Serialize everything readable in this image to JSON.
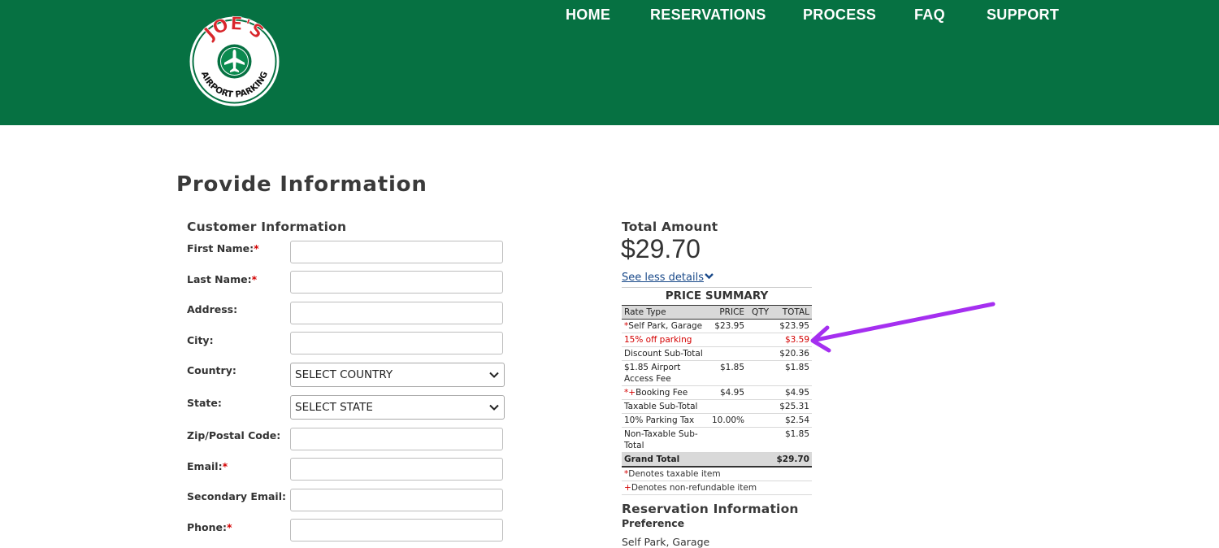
{
  "brand": {
    "logo_text_top": "JOE'S",
    "logo_text_bottom": "AIRPORT PARKING",
    "header_color": "#067142"
  },
  "nav": {
    "items": [
      "HOME",
      "RESERVATIONS",
      "PROCESS",
      "FAQ",
      "SUPPORT"
    ]
  },
  "page": {
    "title": "Provide Information"
  },
  "customer": {
    "heading": "Customer Information",
    "fields": [
      {
        "label": "First Name:",
        "required": "*",
        "value": ""
      },
      {
        "label": "Last Name:",
        "required": "*",
        "value": ""
      },
      {
        "label": "Address:",
        "required": "",
        "value": ""
      },
      {
        "label": "City:",
        "required": "",
        "value": ""
      },
      {
        "label": "Country:",
        "required": "",
        "value": "SELECT COUNTRY"
      },
      {
        "label": "State:",
        "required": "",
        "value": "SELECT STATE"
      },
      {
        "label": "Zip/Postal Code:",
        "required": "",
        "value": ""
      },
      {
        "label": "Email:",
        "required": "*",
        "value": ""
      },
      {
        "label": "Secondary Email:",
        "required": "",
        "value": ""
      },
      {
        "label": "Phone:",
        "required": "*",
        "value": ""
      }
    ]
  },
  "summary": {
    "total_label": "Total Amount",
    "total_amount": "$29.70",
    "details_link": "See less details",
    "table_title": "PRICE SUMMARY",
    "columns": [
      "Rate Type",
      "PRICE",
      "QTY",
      "TOTAL"
    ],
    "rows": [
      {
        "mark": "*",
        "type": "Self Park, Garage",
        "price": "$23.95",
        "qty": "",
        "total": "$23.95",
        "style": "row"
      },
      {
        "mark": "",
        "type": "15% off parking",
        "price": "",
        "qty": "",
        "total": "$3.59",
        "style": "red"
      },
      {
        "mark": "",
        "type": "Discount Sub-Total",
        "price": "",
        "qty": "",
        "total": "$20.36",
        "style": "row"
      },
      {
        "mark": "",
        "type": "$1.85 Airport Access Fee",
        "price": "$1.85",
        "qty": "",
        "total": "$1.85",
        "style": "row"
      },
      {
        "mark": "*+",
        "type": "Booking Fee",
        "price": "$4.95",
        "qty": "",
        "total": "$4.95",
        "style": "row"
      },
      {
        "mark": "",
        "type": "Taxable Sub-Total",
        "price": "",
        "qty": "",
        "total": "$25.31",
        "style": "row"
      },
      {
        "mark": "",
        "type": "10% Parking Tax",
        "price": "10.00%",
        "qty": "",
        "total": "$2.54",
        "style": "row"
      },
      {
        "mark": "",
        "type": "Non-Taxable Sub-Total",
        "price": "",
        "qty": "",
        "total": "$1.85",
        "style": "row"
      }
    ],
    "grand_total_label": "Grand Total",
    "grand_total": "$29.70",
    "notes": [
      {
        "mark": "*",
        "text": "Denotes taxable item"
      },
      {
        "mark": "+",
        "text": "Denotes non-refundable item"
      }
    ]
  },
  "reservation": {
    "heading": "Reservation Information",
    "pref_label": "Preference",
    "pref_value": "Self Park, Garage"
  },
  "annotation": {
    "arrow_color": "#a52ff0"
  }
}
